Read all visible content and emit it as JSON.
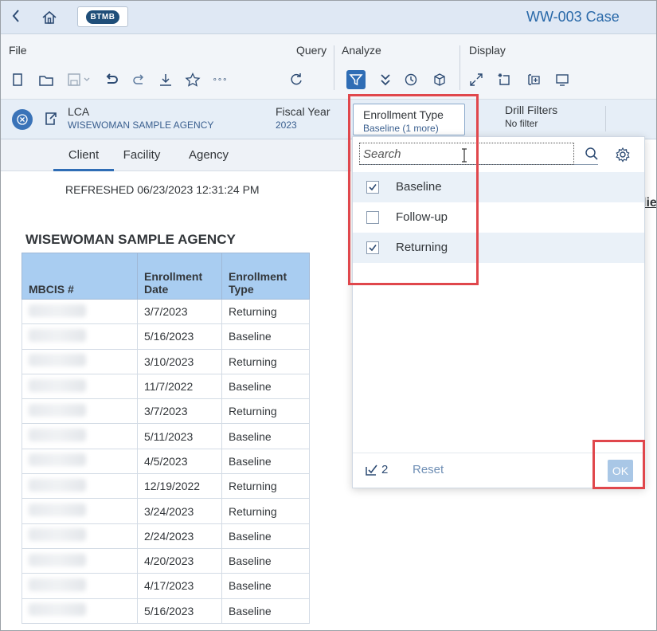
{
  "app": {
    "title": "WW-003 Case",
    "logo_text": "BTMB"
  },
  "toolbar": {
    "groups": {
      "file": "File",
      "query": "Query",
      "analyze": "Analyze",
      "display": "Display"
    },
    "more_glyph": "∘∘∘"
  },
  "filterbar": {
    "lca_label": "LCA",
    "lca_value": "WISEWOMAN SAMPLE AGENCY",
    "fiscal_label": "Fiscal Year",
    "fiscal_value": "2023",
    "enroll_label": "Enrollment Type",
    "enroll_value": "Baseline (1 more)",
    "drill_label": "Drill Filters",
    "drill_value": "No filter"
  },
  "tabs": [
    "Client",
    "Facility",
    "Agency"
  ],
  "report": {
    "refreshed": "REFRESHED 06/23/2023 12:31:24 PM",
    "agency_title": "WISEWOMAN SAMPLE AGENCY",
    "cut_text": "lie",
    "columns": [
      "MBCIS #",
      "Enrollment Date",
      "Enrollment Type"
    ],
    "rows": [
      [
        "3/7/2023",
        "Returning"
      ],
      [
        "5/16/2023",
        "Baseline"
      ],
      [
        "3/10/2023",
        "Returning"
      ],
      [
        "11/7/2022",
        "Baseline"
      ],
      [
        "3/7/2023",
        "Returning"
      ],
      [
        "5/11/2023",
        "Baseline"
      ],
      [
        "4/5/2023",
        "Baseline"
      ],
      [
        "12/19/2022",
        "Returning"
      ],
      [
        "3/24/2023",
        "Returning"
      ],
      [
        "2/24/2023",
        "Baseline"
      ],
      [
        "4/20/2023",
        "Baseline"
      ],
      [
        "4/17/2023",
        "Baseline"
      ],
      [
        "5/16/2023",
        "Baseline"
      ]
    ]
  },
  "popover": {
    "search_placeholder": "Search",
    "options": [
      {
        "label": "Baseline",
        "checked": true
      },
      {
        "label": "Follow-up",
        "checked": false
      },
      {
        "label": "Returning",
        "checked": true
      }
    ],
    "selected_count": "2",
    "reset_label": "Reset",
    "ok_label": "OK"
  },
  "colors": {
    "accent": "#2f6db5",
    "highlight": "#e0474c",
    "header": "#a9cdf1"
  }
}
